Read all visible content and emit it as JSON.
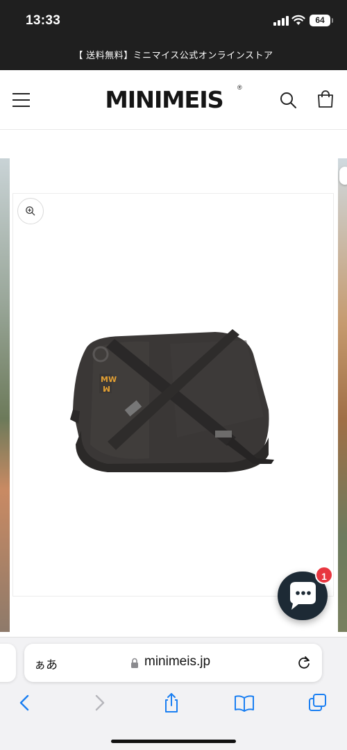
{
  "status_bar": {
    "time": "13:33",
    "battery": "64"
  },
  "announcement": {
    "text": "【 送料無料】ミニマイス公式オンラインストア"
  },
  "header": {
    "logo": "MINIMEIS",
    "logo_mark": "®",
    "menu_icon": "hamburger-menu-icon",
    "search_icon": "search-icon",
    "cart_icon": "cart-icon"
  },
  "product": {
    "zoom_icon": "zoom-in-icon",
    "image": "black-messenger-bag-photo",
    "brand_mark": "MW"
  },
  "chat": {
    "badge_count": "1",
    "icon": "chat-bubble-icon"
  },
  "browser": {
    "text_size_label": "ぁあ",
    "url": "minimeis.jp",
    "toolbar": [
      "back-icon",
      "forward-icon",
      "share-icon",
      "bookmarks-icon",
      "tabs-icon"
    ]
  },
  "colors": {
    "announcement_bg": "#1f1f1f",
    "chat_button": "#1d2a35",
    "badge": "#e8363f",
    "safari_blue": "#1a7ff2"
  }
}
